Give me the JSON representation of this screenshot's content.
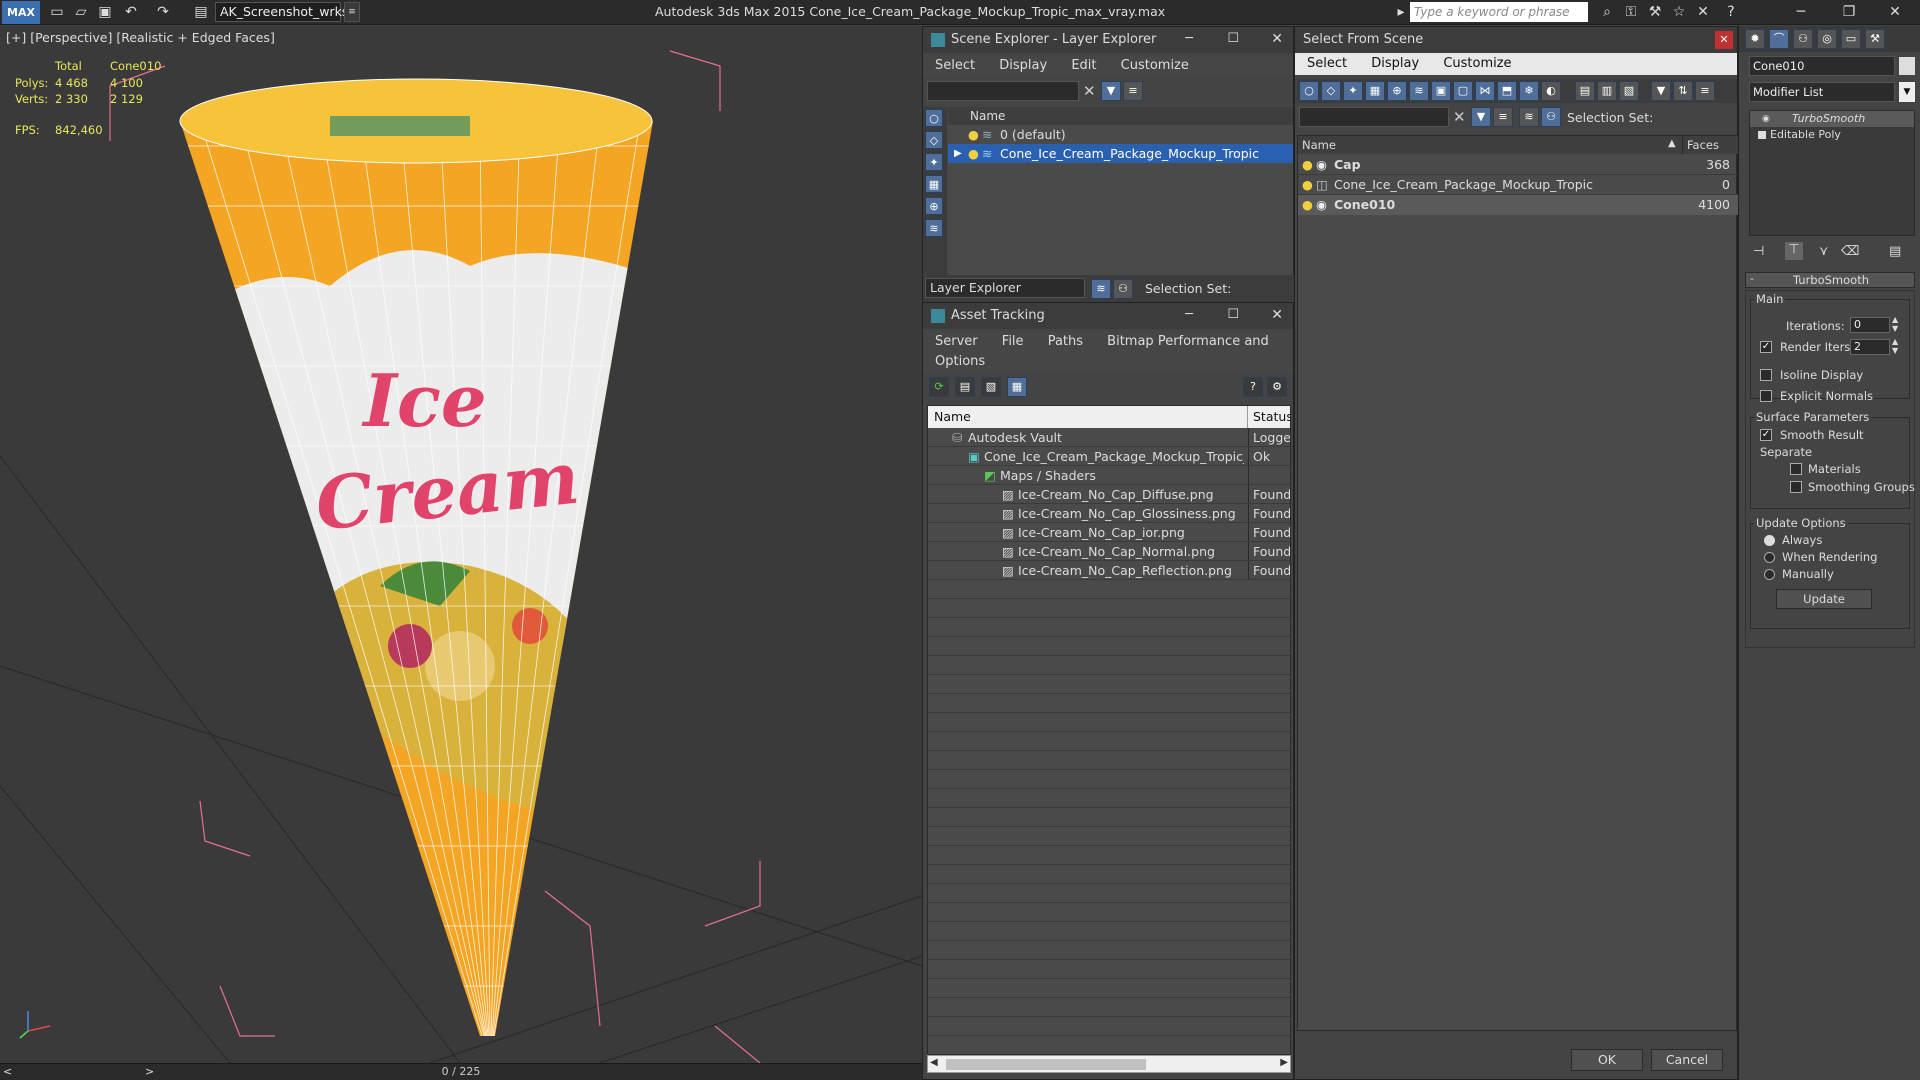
{
  "titlebar": {
    "logo": "MAX",
    "workspace": "AK_Screenshot_wrksp",
    "title": "Autodesk 3ds Max  2015     Cone_Ice_Cream_Package_Mockup_Tropic_max_vray.max",
    "search_placeholder": "Type a keyword or phrase"
  },
  "viewport": {
    "label": "[+] [Perspective] [Realistic + Edged Faces]",
    "stats": {
      "total_label": "Total",
      "object_label": "Cone010",
      "polys_label": "Polys:",
      "polys_total": "4 468",
      "polys_obj": "4 100",
      "verts_label": "Verts:",
      "verts_total": "2 330",
      "verts_obj": "2 129",
      "fps_label": "FPS:",
      "fps_value": "842,460"
    },
    "cone_text": [
      "Ice",
      "Cream"
    ],
    "colors": {
      "orange": "#f5a524",
      "white": "#ececec",
      "pink": "#e0446a",
      "bg": "#3a3a3a"
    }
  },
  "timebar": {
    "value": "0 / 225",
    "prev": "<",
    "next": ">"
  },
  "scene_explorer": {
    "title": "Scene Explorer - Layer Explorer",
    "menu": [
      "Select",
      "Display",
      "Edit",
      "Customize"
    ],
    "column": "Name",
    "rows": [
      "0 (default)",
      "Cone_Ice_Cream_Package_Mockup_Tropic"
    ],
    "footer_label": "Layer Explorer",
    "selection_set": "Selection Set:"
  },
  "asset_tracking": {
    "title": "Asset Tracking",
    "menu": [
      "Server",
      "File",
      "Paths",
      "Bitmap Performance and Memory"
    ],
    "menu2": "Options",
    "columns": [
      "Name",
      "Status"
    ],
    "rows": [
      {
        "name": "Autodesk Vault",
        "status": "Logged"
      },
      {
        "name": "Cone_Ice_Cream_Package_Mockup_Tropic_max...",
        "status": "Ok"
      },
      {
        "name": "Maps / Shaders",
        "status": ""
      },
      {
        "name": "Ice-Cream_No_Cap_Diffuse.png",
        "status": "Found"
      },
      {
        "name": "Ice-Cream_No_Cap_Glossiness.png",
        "status": "Found"
      },
      {
        "name": "Ice-Cream_No_Cap_ior.png",
        "status": "Found"
      },
      {
        "name": "Ice-Cream_No_Cap_Normal.png",
        "status": "Found"
      },
      {
        "name": "Ice-Cream_No_Cap_Reflection.png",
        "status": "Found"
      }
    ]
  },
  "select_from_scene": {
    "title": "Select From Scene",
    "menu": [
      "Select",
      "Display",
      "Customize"
    ],
    "selection_set": "Selection Set:",
    "columns": [
      "Name",
      "Faces"
    ],
    "rows": [
      {
        "name": "Cap",
        "faces": "368"
      },
      {
        "name": "Cone_Ice_Cream_Package_Mockup_Tropic",
        "faces": "0"
      },
      {
        "name": "Cone010",
        "faces": "4100"
      }
    ],
    "ok": "OK",
    "cancel": "Cancel"
  },
  "command_panel": {
    "object_name": "Cone010",
    "modifier_list": "Modifier List",
    "stack": [
      "TurboSmooth",
      "Editable Poly"
    ],
    "rollout": "TurboSmooth",
    "main_group": "Main",
    "iterations_label": "Iterations:",
    "iterations": "0",
    "render_iters_label": "Render Iters:",
    "render_iters": "2",
    "isoline": "Isoline Display",
    "explicit_normals": "Explicit Normals",
    "surface_group": "Surface Parameters",
    "smooth_result": "Smooth Result",
    "separate": "Separate",
    "materials": "Materials",
    "smoothing_groups": "Smoothing Groups",
    "update_group": "Update Options",
    "always": "Always",
    "when_rendering": "When Rendering",
    "manually": "Manually",
    "update_button": "Update"
  }
}
